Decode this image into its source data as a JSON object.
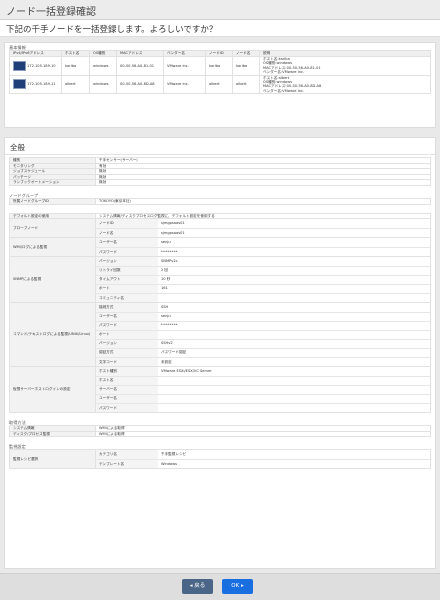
{
  "window": {
    "title": "ノード一括登録確認"
  },
  "banner": {
    "text": "下記の千手ノードを一括登録します。よろしいですか？"
  },
  "basic": {
    "section": "基本情報",
    "headers": [
      "IPv4/IPv6アドレス",
      "ホスト名",
      "OS種別",
      "MACアドレス",
      "ベンダー名",
      "ノードID",
      "ノード名",
      "説明"
    ],
    "rows": [
      [
        "172.105.189.10",
        "kariba",
        "windows",
        "00-50-56-A0-81-01",
        "VMware Inc.",
        "kariba",
        "kariba",
        "ホスト名:kariba\nOS種別:windows\nMACアドレス:00-50-56-A0-81-01\nベンダー名:VMware Inc."
      ],
      [
        "172.105.189.11",
        "albert",
        "windows",
        "00-50-56-A0-8D-A8",
        "VMware Inc.",
        "albert",
        "albert",
        "ホスト名:albert\nOS種別:windows\nMACアドレス:00-50-56-A0-8D-A8\nベンダー名:VMware Inc."
      ]
    ]
  },
  "general": {
    "title": "全般",
    "rows": [
      {
        "label": "種別",
        "value": "千手センサー(サーバー)"
      },
      {
        "label": "モニタリング",
        "value": "有効"
      },
      {
        "label": "ジョブスケジュール",
        "value": "無効"
      },
      {
        "label": "パッチージ",
        "value": "無効"
      },
      {
        "label": "ランブックオートメーション",
        "value": "無効"
      }
    ],
    "node_group": {
      "section": "ノードグループ",
      "label": "所属ノードグループID",
      "value": "TOKOYO(東京本社)"
    },
    "default": {
      "label": "デフォルト設定の使用",
      "value": "システム情報/ディスクプロセスログ監視に、デフォルト設定を使用する"
    },
    "proxy": {
      "label": "プロ一ブノード",
      "rows": [
        {
          "k": "ノードID",
          "v": "sjmgpsaas01"
        },
        {
          "k": "ノード名",
          "v": "sjmgpsaas01"
        }
      ]
    },
    "wmi": {
      "label": "WMI/ログによる監視",
      "rows": [
        {
          "k": "ユーザー名",
          "v": "senju"
        },
        {
          "k": "パスワード",
          "v": "********"
        }
      ]
    },
    "snmp": {
      "label": "SNMPによる監視",
      "rows": [
        {
          "k": "バージョン",
          "v": "SNMPv2c"
        },
        {
          "k": "リトライ回数",
          "v": "2 回"
        },
        {
          "k": "タイムアウト",
          "v": "10 秒"
        },
        {
          "k": "ポート",
          "v": "161"
        },
        {
          "k": "コミュニティ名",
          "v": ""
        }
      ]
    },
    "cmd": {
      "label": "コマンド/テキストログによる監視(UNIX/Linux)",
      "rows": [
        {
          "k": "接続方式",
          "v": "SSH"
        },
        {
          "k": "ユーザー名",
          "v": "senju"
        },
        {
          "k": "パスワード",
          "v": "********"
        },
        {
          "k": "ポート",
          "v": ""
        },
        {
          "k": "バージョン",
          "v": "SSHv2"
        },
        {
          "k": "認証方式",
          "v": "パスワード認証"
        },
        {
          "k": "文字コード",
          "v": "未設定"
        }
      ]
    },
    "vhost": {
      "label": "仮想サーバーホストログインの設定",
      "rows": [
        {
          "k": "ホスト種別",
          "v": "VMware ESXi/ESX/VC Server"
        },
        {
          "k": "ホスト名",
          "v": ""
        },
        {
          "k": "サーバー名",
          "v": ""
        },
        {
          "k": "ユーザー名",
          "v": ""
        },
        {
          "k": "パスワード",
          "v": ""
        }
      ]
    },
    "acquire": {
      "section": "取得方法",
      "rows": [
        {
          "label": "システム情報",
          "value": "WMIによる取得"
        },
        {
          "label": "ディスク/プロセス監視",
          "value": "WMIによる取得"
        }
      ]
    },
    "monitor": {
      "section": "監視設定",
      "label": "監視レシピ選択",
      "rows": [
        {
          "k": "カテゴリ名",
          "v": "千手監視レシピ"
        },
        {
          "k": "テンプレート名",
          "v": "Windows"
        }
      ]
    }
  },
  "footer": {
    "back_label": "◂ 戻る",
    "ok_label": "OK ▸"
  },
  "colors": {
    "ok": "#1a6fe0",
    "back": "#4a6587"
  }
}
